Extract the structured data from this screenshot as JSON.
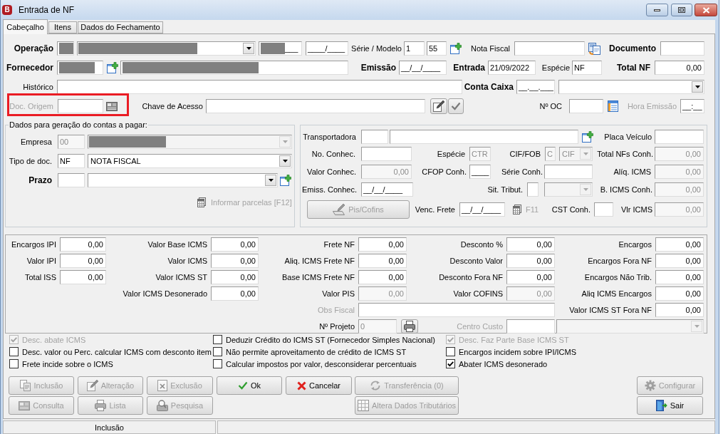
{
  "window": {
    "app_badge": "B",
    "title": "Entrada de NF"
  },
  "tabs": [
    {
      "label": "Cabeçalho",
      "selected": true
    },
    {
      "label": "Itens",
      "selected": false
    },
    {
      "label": "Dados do Fechamento",
      "selected": false
    }
  ],
  "header": {
    "operacao": {
      "label": "Operação",
      "code": {
        "redacted": true
      },
      "description": {
        "redacted": true
      },
      "field_3": {
        "redacted": true,
        "value": "___"
      },
      "field_4": {
        "value": "____/____"
      }
    },
    "serie_modelo": {
      "label": "Série / Modelo",
      "serie": "1",
      "modelo": "55"
    },
    "nota_fiscal": {
      "label": "Nota Fiscal"
    },
    "documento": {
      "label": "Documento"
    },
    "fornecedor": {
      "label": "Fornecedor",
      "code": {
        "redacted": true
      },
      "name": {
        "redacted": true
      }
    },
    "emissao": {
      "label": "Emissão",
      "value": "__/__/____"
    },
    "entrada": {
      "label": "Entrada",
      "value": "21/09/2022"
    },
    "especie": {
      "label": "Espécie",
      "value": "NF"
    },
    "total_nf": {
      "label": "Total NF",
      "value": "0,00"
    },
    "historico": {
      "label": "Histórico"
    },
    "conta_caixa": {
      "label": "Conta Caixa",
      "value": "__.__.___"
    },
    "doc_origem": {
      "label": "Doc. Origem",
      "disabled": true,
      "highlighted": true
    },
    "chave_de_acesso": {
      "label": "Chave de Acesso"
    },
    "n_oc": {
      "label": "Nº OC"
    },
    "hora_emissao": {
      "label": "Hora Emissão",
      "value": "__:__",
      "disabled": true
    }
  },
  "contas_a_pagar": {
    "title": "Dados para geração do contas a pagar:",
    "empresa": {
      "label": "Empresa",
      "code": "00",
      "disabled": true,
      "name": {
        "redacted": true
      }
    },
    "tipo_de_doc": {
      "label": "Tipo de doc.",
      "code": "NF",
      "name": "NOTA FISCAL"
    },
    "prazo": {
      "label": "Prazo"
    },
    "informar_parcelas": {
      "label": "Informar parcelas [F12]",
      "disabled": true
    }
  },
  "transporte": {
    "transportadora": {
      "label": "Transportadora"
    },
    "placa_veiculo": {
      "label": "Placa Veículo"
    },
    "no_conhec": {
      "label": "No. Conhec."
    },
    "especie": {
      "label": "Espécie",
      "value": "CTR",
      "disabled": true
    },
    "cif_fob": {
      "label": "CIF/FOB",
      "code": "C",
      "option": "CIF",
      "disabled": true
    },
    "total_nfs_conh": {
      "label": "Total NFs Conh.",
      "value": "0,00",
      "disabled": true
    },
    "valor_conhec": {
      "label": "Valor Conhec.",
      "value": "0,00",
      "disabled": true
    },
    "cfop_conh": {
      "label": "CFOP Conh.",
      "value": "____"
    },
    "serie_conh": {
      "label": "Série Conh."
    },
    "aliq_icms": {
      "label": "Alíq. ICMS",
      "value": "0,00",
      "disabled": true
    },
    "emiss_conhec": {
      "label": "Emiss. Conhec.",
      "value": "__/__/____"
    },
    "sit_tribut": {
      "label": "Sit. Tribut.",
      "disabled": true
    },
    "b_icms_conh": {
      "label": "B. ICMS Conh.",
      "value": "0,00",
      "disabled": true
    },
    "pis_cofins": {
      "label": "Pis/Cofins",
      "disabled": true
    },
    "venc_frete": {
      "label": "Venc. Frete",
      "value": "__/__/____"
    },
    "f11": {
      "label": "F11",
      "disabled": true
    },
    "cst_conh": {
      "label": "CST Conh."
    },
    "vlr_icms": {
      "label": "Vlr ICMS",
      "value": "0,00",
      "disabled": true
    }
  },
  "totais": {
    "columns": [
      [
        {
          "label": "Encargos IPI",
          "value": "0,00",
          "disabled": false
        },
        {
          "label": "Valor IPI",
          "value": "0,00",
          "disabled": false
        },
        {
          "label": "Total ISS",
          "value": "0,00",
          "disabled": false
        }
      ],
      [
        {
          "label": "Valor Base ICMS",
          "value": "0,00",
          "disabled": false
        },
        {
          "label": "Valor ICMS",
          "value": "0,00",
          "disabled": false
        },
        {
          "label": "Valor ICMS ST",
          "value": "0,00",
          "disabled": false
        },
        {
          "label": "Valor ICMS Desonerado",
          "value": "0,00",
          "disabled": false
        }
      ],
      [
        {
          "label": "Frete NF",
          "value": "0,00",
          "disabled": false
        },
        {
          "label": "Aliq. ICMS Frete NF",
          "value": "0,00",
          "disabled": false
        },
        {
          "label": "Base ICMS Frete NF",
          "value": "0,00",
          "disabled": false
        },
        {
          "label": "Valor PIS",
          "value": "0,00",
          "disabled": true
        }
      ],
      [
        {
          "label": "Desconto %",
          "value": "0,00",
          "disabled": false
        },
        {
          "label": "Desconto Valor",
          "value": "0,00",
          "disabled": false
        },
        {
          "label": "Desconto Fora NF",
          "value": "0,00",
          "disabled": false
        },
        {
          "label": "Valor COFINS",
          "value": "0,00",
          "disabled": true
        }
      ],
      [
        {
          "label": "Encargos",
          "value": "0,00",
          "disabled": false
        },
        {
          "label": "Encargos Fora NF",
          "value": "0,00",
          "disabled": false
        },
        {
          "label": "Encargos Não Trib.",
          "value": "0,00",
          "disabled": false
        },
        {
          "label": "Aliq ICMS Encargos",
          "value": "0,00",
          "disabled": false
        },
        {
          "label": "Valor ICMS ST Fora NF",
          "value": "0,00",
          "disabled": false
        }
      ]
    ],
    "obs_fiscal": {
      "label": "Obs Fiscal",
      "disabled": true
    },
    "n_projeto": {
      "label": "Nº Projeto",
      "value": "0",
      "disabled": true
    },
    "centro_custo": {
      "label": "Centro Custo",
      "disabled": true
    }
  },
  "options": {
    "columns": [
      [
        {
          "label": "Desc. abate ICMS",
          "checked": true,
          "disabled": true
        },
        {
          "label": "Desc. valor ou Perc. calcular ICMS com desconto item",
          "checked": false,
          "disabled": false
        },
        {
          "label": "Frete incide sobre o ICMS",
          "checked": false,
          "disabled": false
        }
      ],
      [
        {
          "label": "Deduzir Crédito do ICMS ST (Fornecedor Simples Nacional)",
          "checked": false,
          "disabled": false
        },
        {
          "label": "Não permite aproveitamento de crédito de ICMS ST",
          "checked": false,
          "disabled": false
        },
        {
          "label": "Calcular impostos por valor, desconsiderar percentuais",
          "checked": false,
          "disabled": false
        }
      ],
      [
        {
          "label": "Desc. Faz Parte Base ICMS ST",
          "checked": true,
          "disabled": true
        },
        {
          "label": "Encargos incidem sobre IPI/ICMS",
          "checked": false,
          "disabled": false
        },
        {
          "label": "Abater ICMS desonerado",
          "checked": true,
          "disabled": false
        }
      ]
    ]
  },
  "buttons": [
    {
      "label": "Inclusão",
      "disabled": true
    },
    {
      "label": "Alteração",
      "disabled": true
    },
    {
      "label": "Exclusão",
      "disabled": true
    },
    {
      "label": "Ok",
      "disabled": false
    },
    {
      "label": "Cancelar",
      "disabled": false
    },
    {
      "label": "Transferência (0)",
      "disabled": true
    },
    {
      "label": "Configurar",
      "disabled": true
    },
    {
      "label": "Consulta",
      "disabled": true
    },
    {
      "label": "Lista",
      "disabled": true
    },
    {
      "label": "Pesquisa",
      "disabled": true
    },
    {
      "label": "Altera Dados Tributários",
      "disabled": true
    },
    {
      "label": "Sair",
      "disabled": false
    }
  ],
  "status_bar": {
    "panel_1": "Inclusão"
  }
}
